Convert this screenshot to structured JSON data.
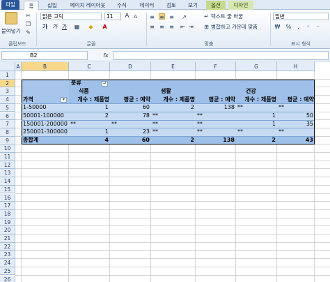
{
  "ribbon_tabs": [
    "파일",
    "홈",
    "삽입",
    "페이지 레이아웃",
    "수식",
    "데이터",
    "검토",
    "보기",
    "옵션",
    "디자인"
  ],
  "ribbon": {
    "paste_label": "붙여넣기",
    "clipboard_group": "클립보드",
    "font_name": "맑은 고딕",
    "font_size": "11",
    "font_group": "글꼴",
    "wrap_text": "텍스트 줄 바꿈",
    "merge_center": "병합하고 가운데 맞춤",
    "align_group": "맞춤",
    "number_format": "일반",
    "number_group": "표시 형식",
    "bold": "가",
    "italic": "가",
    "underline": "가"
  },
  "formula_bar": {
    "cell_ref": "B2",
    "fx": "fx",
    "value": ""
  },
  "columns": [
    "A",
    "B",
    "C",
    "D",
    "E",
    "F",
    "G",
    "H"
  ],
  "rows": [
    "1",
    "2",
    "3",
    "4",
    "5",
    "6",
    "7",
    "8",
    "9",
    "10",
    "11",
    "12",
    "13",
    "14",
    "15",
    "16",
    "17",
    "18",
    "19",
    "20",
    "21",
    "22",
    "23",
    "24",
    "25",
    "26"
  ],
  "selected_column": "B",
  "selected_row": "2",
  "pivot": {
    "r2_field": "분류",
    "r3_cats": [
      "식품",
      "생활",
      "건강"
    ],
    "r4_rowfield": "가격",
    "r4_headers": [
      "개수 : 제품명",
      "평균 : 예약",
      "개수 : 제품명",
      "평균 : 예약",
      "개수 : 제품명",
      "평균 : 예약"
    ],
    "data_rows": [
      {
        "label": "1-50000",
        "values": [
          "1",
          "60",
          "2",
          "138",
          "**",
          "**"
        ]
      },
      {
        "label": "50001-100000",
        "values": [
          "2",
          "78",
          "**",
          "**",
          "1",
          "50"
        ]
      },
      {
        "label": "150001-200000",
        "values": [
          "**",
          "**",
          "**",
          "**",
          "1",
          "35"
        ]
      },
      {
        "label": "250001-300000",
        "values": [
          "1",
          "23",
          "**",
          "**",
          "**",
          "**"
        ]
      }
    ],
    "total": {
      "label": "총합계",
      "values": [
        "4",
        "60",
        "2",
        "138",
        "2",
        "43"
      ]
    }
  }
}
